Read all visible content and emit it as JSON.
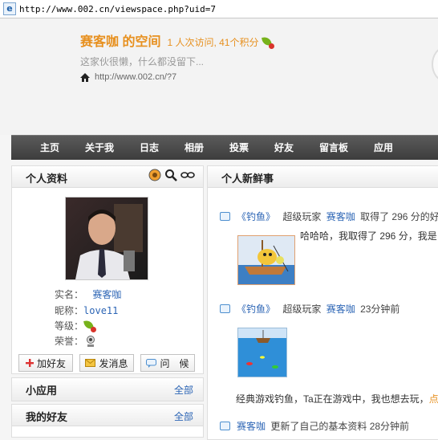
{
  "browser": {
    "url": "http://www.002.cn/viewspace.php?uid=7",
    "icon": "ie-page-icon"
  },
  "header": {
    "space_title": "赛客咖  的空间",
    "stats": "1 人次访问, 41个积分",
    "motto": "这家伙很懒，什么都没留下...",
    "home_url": "http://www.002.cn/?7"
  },
  "nav": {
    "items": [
      "主页",
      "关于我",
      "日志",
      "相册",
      "投票",
      "好友",
      "留言板",
      "应用"
    ]
  },
  "profile": {
    "title": "个人资料",
    "fields": [
      {
        "label": "实名：",
        "value": "赛客咖"
      },
      {
        "label": "昵称：",
        "value": "love11"
      },
      {
        "label": "等级：",
        "value": ""
      },
      {
        "label": "荣誉：",
        "value": ""
      }
    ],
    "buttons": {
      "add_friend": "加好友",
      "send_message": "发消息",
      "greet": "问　候"
    }
  },
  "apps_panel": {
    "title": "小应用",
    "more": "全部"
  },
  "friends_panel": {
    "title": "我的好友",
    "more": "全部"
  },
  "news": {
    "title": "个人新鲜事",
    "entries": [
      {
        "app": "《钓鱼》",
        "role": "超级玩家",
        "user": "赛客咖",
        "action": "取得了  296 分的好",
        "detail": "哈哈哈，我取得了  296 分，我是"
      },
      {
        "app": "《钓鱼》",
        "role": "超级玩家",
        "user": "赛客咖",
        "action": "23分钟前",
        "detail": "经典游戏钓鱼，Ta正在游戏中，我也想去玩，",
        "link": "点"
      },
      {
        "user": "赛客咖",
        "action": "更新了自己的基本资料  28分钟前"
      }
    ]
  },
  "colors": {
    "accent": "#e7901f",
    "link": "#2c65b5",
    "nav_bg": "#474747"
  }
}
